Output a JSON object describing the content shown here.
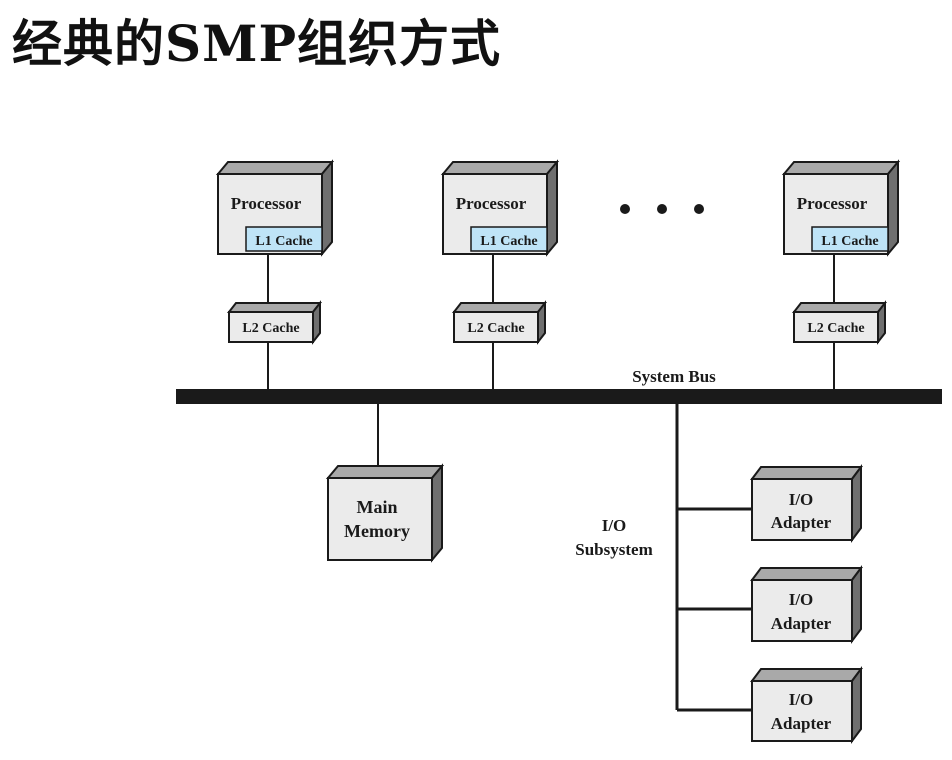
{
  "title": "经典的SMP组织方式",
  "diagram": {
    "processor_label": "Processor",
    "l1_label": "L1 Cache",
    "l2_label": "L2 Cache",
    "bus_label": "System Bus",
    "memory_label": [
      "Main",
      "Memory"
    ],
    "io_subsystem_label": [
      "I/O",
      "Subsystem"
    ],
    "io_adapter_label": [
      "I/O",
      "Adapter"
    ],
    "colors": {
      "box_fill": "#ebebeb",
      "box_side": "#6f6f6f",
      "box_top": "#a9a9a9",
      "l1_fill": "#bfe4f7",
      "line": "#1a1a1a"
    }
  }
}
